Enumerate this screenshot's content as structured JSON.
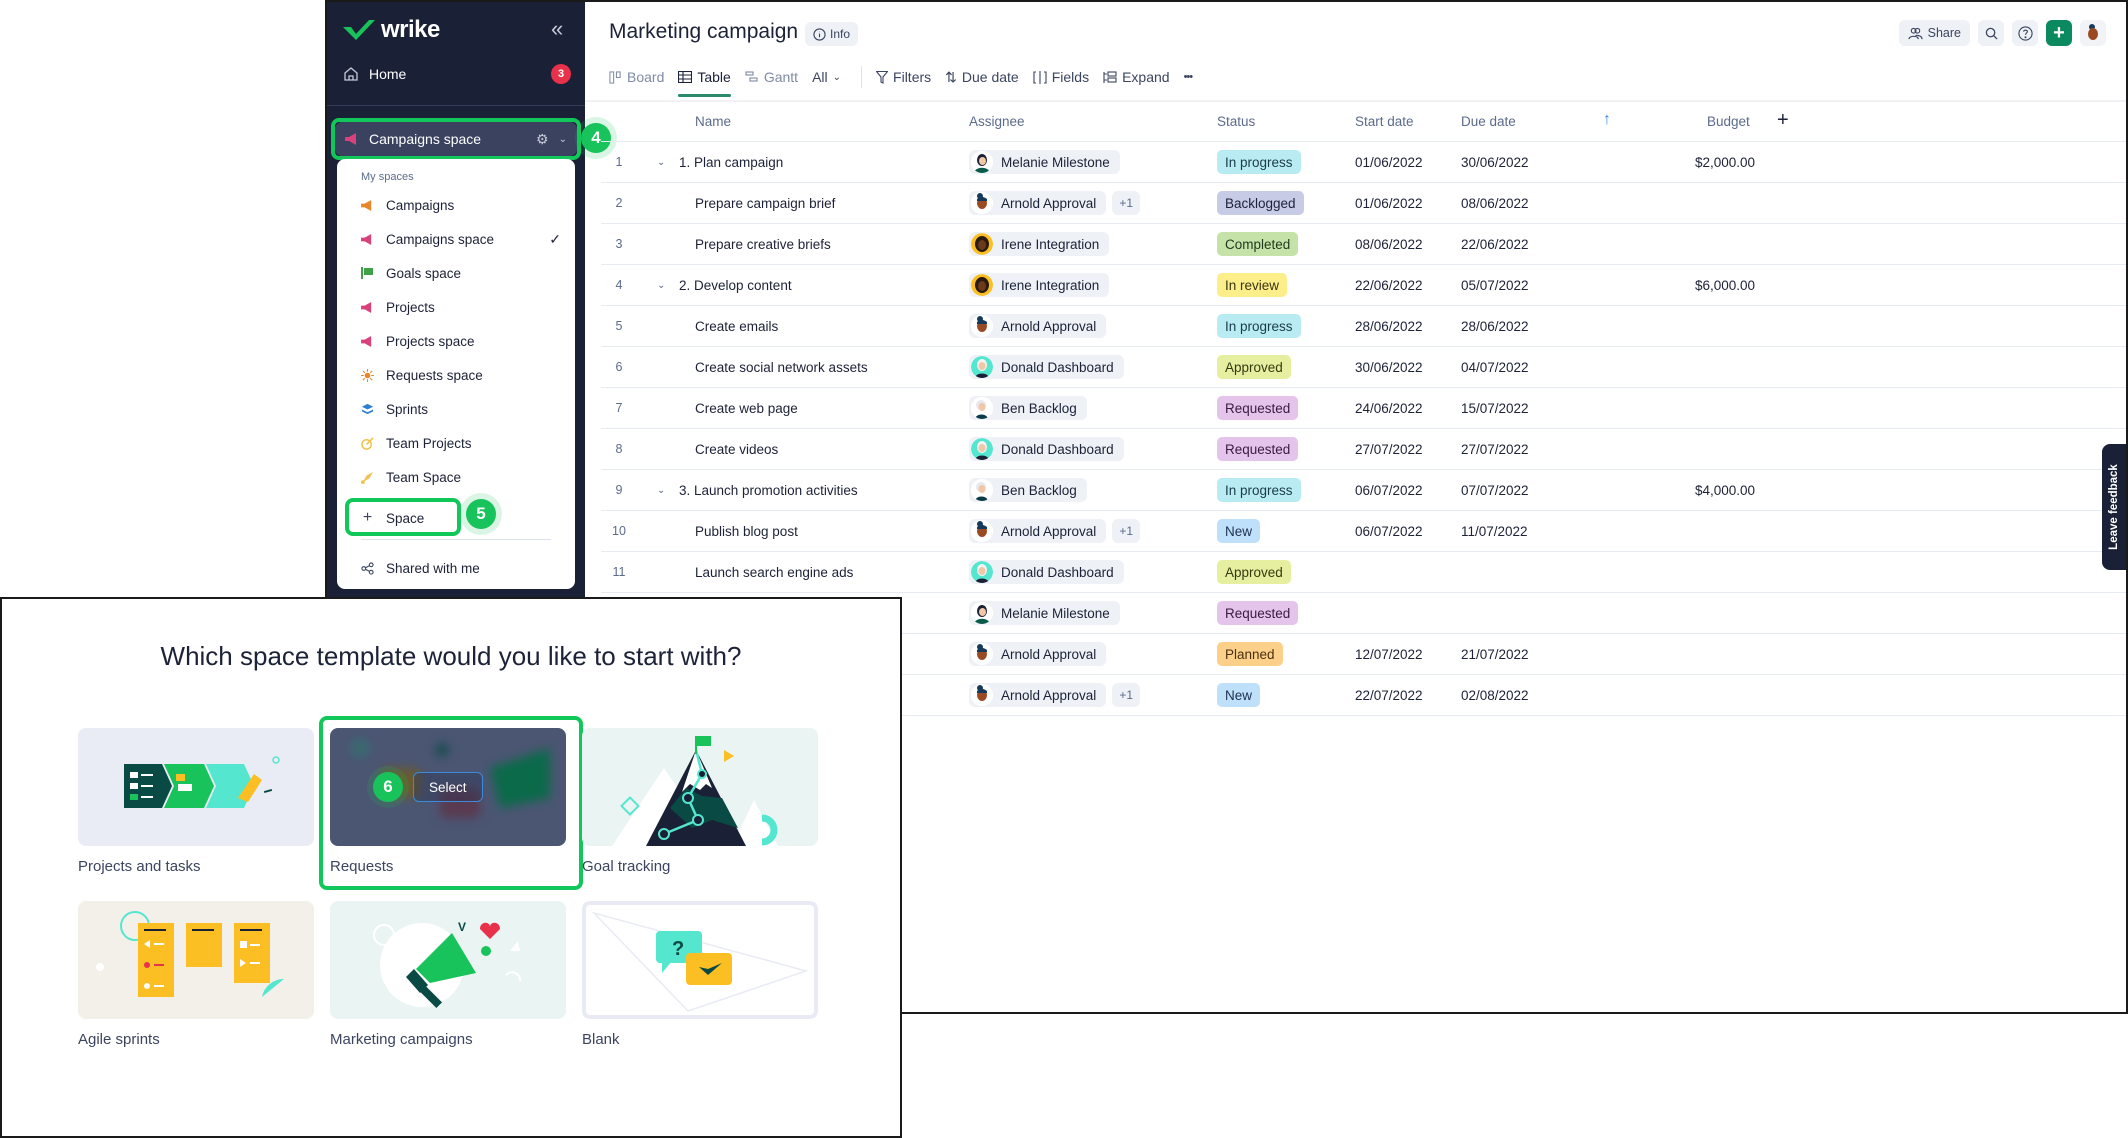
{
  "sidebar": {
    "logo_text": "wrike",
    "collapse_icon": "double-chevron-left",
    "home": {
      "label": "Home",
      "badge": "3"
    },
    "current_space": "Campaigns space",
    "step_badge_space_selector": "4",
    "dropdown": {
      "header": "My spaces",
      "items": [
        {
          "label": "Campaigns",
          "icon": "megaphone",
          "color": "#e8862b",
          "selected": false
        },
        {
          "label": "Campaigns space",
          "icon": "megaphone",
          "color": "#d8417a",
          "selected": true
        },
        {
          "label": "Goals space",
          "icon": "flag",
          "color": "#3fa14a",
          "selected": false
        },
        {
          "label": "Projects",
          "icon": "megaphone",
          "color": "#d8417a",
          "selected": false
        },
        {
          "label": "Projects space",
          "icon": "megaphone",
          "color": "#d8417a",
          "selected": false
        },
        {
          "label": "Requests space",
          "icon": "sun",
          "color": "#e8862b",
          "selected": false
        },
        {
          "label": "Sprints",
          "icon": "layers",
          "color": "#2b7fd6",
          "selected": false
        },
        {
          "label": "Team Projects",
          "icon": "target",
          "color": "#f0c24a",
          "selected": false
        },
        {
          "label": "Team Space",
          "icon": "rocket",
          "color": "#f0c24a",
          "selected": false
        }
      ],
      "add_space_label": "Space",
      "step_badge_add_space": "5",
      "shared_label": "Shared with me"
    }
  },
  "header": {
    "title": "Marketing campaign",
    "info_label": "Info",
    "share_label": "Share"
  },
  "toolbar": {
    "views": [
      {
        "label": "Board",
        "active": false
      },
      {
        "label": "Table",
        "active": true
      },
      {
        "label": "Gantt",
        "active": false
      }
    ],
    "filter_scope": "All",
    "filters_label": "Filters",
    "sort_label": "Due date",
    "fields_label": "Fields",
    "expand_label": "Expand",
    "more_label": "•••"
  },
  "table": {
    "columns": {
      "name": "Name",
      "assignee": "Assignee",
      "status": "Status",
      "start": "Start date",
      "due": "Due date",
      "budget": "Budget"
    },
    "rows": [
      {
        "num": "1",
        "name": "1. Plan campaign",
        "parent": true,
        "assignee": "Melanie Milestone",
        "av": "melanie",
        "extra": "",
        "status": "In progress",
        "start": "01/06/2022",
        "due": "30/06/2022",
        "budget": "$2,000.00"
      },
      {
        "num": "2",
        "name": "Prepare campaign brief",
        "parent": false,
        "assignee": "Arnold Approval",
        "av": "arnold",
        "extra": "+1",
        "status": "Backlogged",
        "start": "01/06/2022",
        "due": "08/06/2022",
        "budget": ""
      },
      {
        "num": "3",
        "name": "Prepare creative briefs",
        "parent": false,
        "assignee": "Irene Integration",
        "av": "irene",
        "extra": "",
        "status": "Completed",
        "start": "08/06/2022",
        "due": "22/06/2022",
        "budget": ""
      },
      {
        "num": "4",
        "name": "2. Develop content",
        "parent": true,
        "assignee": "Irene Integration",
        "av": "irene",
        "extra": "",
        "status": "In review",
        "start": "22/06/2022",
        "due": "05/07/2022",
        "budget": "$6,000.00"
      },
      {
        "num": "5",
        "name": "Create emails",
        "parent": false,
        "assignee": "Arnold Approval",
        "av": "arnold",
        "extra": "",
        "status": "In progress",
        "start": "28/06/2022",
        "due": "28/06/2022",
        "budget": ""
      },
      {
        "num": "6",
        "name": "Create social network assets",
        "parent": false,
        "assignee": "Donald Dashboard",
        "av": "donald",
        "extra": "",
        "status": "Approved",
        "start": "30/06/2022",
        "due": "04/07/2022",
        "budget": ""
      },
      {
        "num": "7",
        "name": "Create web page",
        "parent": false,
        "assignee": "Ben Backlog",
        "av": "ben",
        "extra": "",
        "status": "Requested",
        "start": "24/06/2022",
        "due": "15/07/2022",
        "budget": ""
      },
      {
        "num": "8",
        "name": "Create videos",
        "parent": false,
        "assignee": "Donald Dashboard",
        "av": "donald",
        "extra": "",
        "status": "Requested",
        "start": "27/07/2022",
        "due": "27/07/2022",
        "budget": ""
      },
      {
        "num": "9",
        "name": "3. Launch promotion activities",
        "parent": true,
        "assignee": "Ben Backlog",
        "av": "ben",
        "extra": "",
        "status": "In progress",
        "start": "06/07/2022",
        "due": "07/07/2022",
        "budget": "$4,000.00"
      },
      {
        "num": "10",
        "name": "Publish blog post",
        "parent": false,
        "assignee": "Arnold Approval",
        "av": "arnold",
        "extra": "+1",
        "status": "New",
        "start": "06/07/2022",
        "due": "11/07/2022",
        "budget": ""
      },
      {
        "num": "11",
        "name": "Launch search engine ads",
        "parent": false,
        "assignee": "Donald Dashboard",
        "av": "donald",
        "extra": "",
        "status": "Approved",
        "start": "",
        "due": "",
        "budget": ""
      },
      {
        "num": "",
        "name": "",
        "parent": false,
        "assignee": "Melanie Milestone",
        "av": "melanie",
        "extra": "",
        "status": "Requested",
        "start": "",
        "due": "",
        "budget": ""
      },
      {
        "num": "",
        "name": "",
        "parent": false,
        "assignee": "Arnold Approval",
        "av": "arnold",
        "extra": "",
        "status": "Planned",
        "start": "12/07/2022",
        "due": "21/07/2022",
        "budget": ""
      },
      {
        "num": "",
        "name": "",
        "parent": false,
        "assignee": "Arnold Approval",
        "av": "arnold",
        "extra": "+1",
        "status": "New",
        "start": "22/07/2022",
        "due": "02/08/2022",
        "budget": ""
      }
    ],
    "status_colors": {
      "In progress": {
        "bg": "#b8ecf2",
        "fg": "#1c3a4a"
      },
      "Backlogged": {
        "bg": "#c7cbe6",
        "fg": "#1c2237"
      },
      "Completed": {
        "bg": "#c5e3a8",
        "fg": "#1c3a1c"
      },
      "In review": {
        "bg": "#fcef8a",
        "fg": "#3a3410"
      },
      "Approved": {
        "bg": "#e6efa0",
        "fg": "#333a10"
      },
      "Requested": {
        "bg": "#e4c4ea",
        "fg": "#3a1c40"
      },
      "New": {
        "bg": "#bfe0fb",
        "fg": "#1c3050"
      },
      "Planned": {
        "bg": "#fdd08a",
        "fg": "#4a3010"
      }
    }
  },
  "feedback_label": "Leave feedback",
  "picker": {
    "title": "Which space template would you like to start with?",
    "select_label": "Select",
    "step_badge": "6",
    "templates": [
      {
        "label": "Projects and tasks",
        "highlighted": false
      },
      {
        "label": "Requests",
        "highlighted": true
      },
      {
        "label": "Goal tracking",
        "highlighted": false
      },
      {
        "label": "Agile sprints",
        "highlighted": false
      },
      {
        "label": "Marketing campaigns",
        "highlighted": false
      },
      {
        "label": "Blank",
        "highlighted": false
      }
    ]
  },
  "accent_colors": {
    "brand_green": "#0b8a5f",
    "highlight_green": "#12c75a",
    "sidebar_bg": "#1a2035"
  }
}
